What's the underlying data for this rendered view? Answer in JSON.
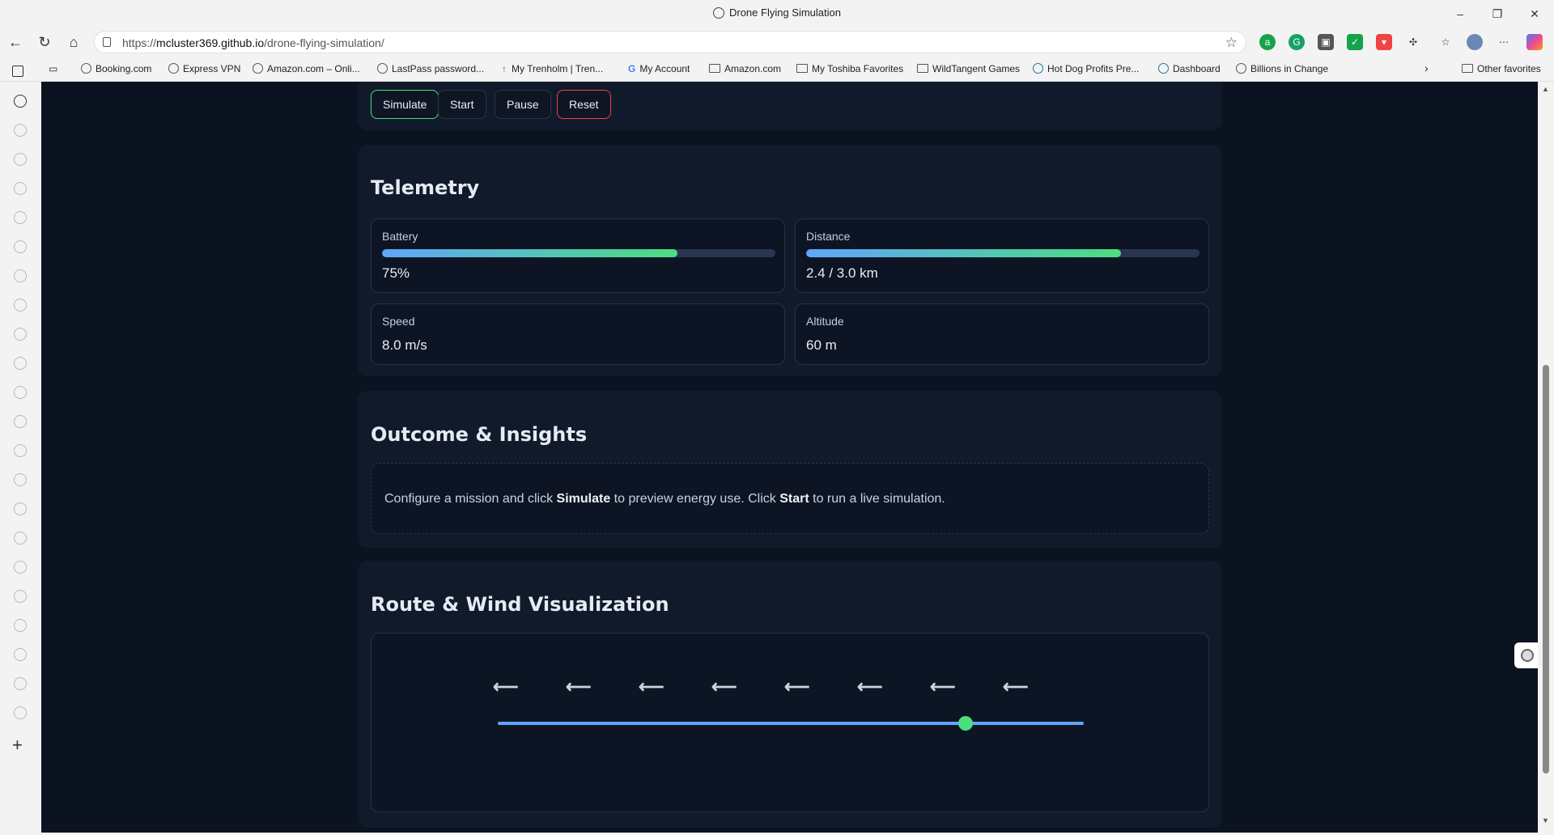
{
  "window": {
    "title": "Drone Flying Simulation",
    "controls": {
      "minimize": "–",
      "restore": "❐",
      "close": "✕"
    }
  },
  "address_bar": {
    "url_prefix": "https://",
    "url_host": "mcluster369.github.io",
    "url_path": "/drone-flying-simulation/"
  },
  "bookmarks": [
    {
      "label": "Booking.com",
      "icon": "globe-icon"
    },
    {
      "label": "Express VPN",
      "icon": "globe-icon"
    },
    {
      "label": "Amazon.com – Onli...",
      "icon": "globe-icon"
    },
    {
      "label": "LastPass password...",
      "icon": "globe-icon"
    },
    {
      "label": "My Trenholm | Tren...",
      "icon": "pin-icon"
    },
    {
      "label": "My Account",
      "icon": "google-icon"
    },
    {
      "label": "Amazon.com",
      "icon": "folder-icon"
    },
    {
      "label": "My Toshiba Favorites",
      "icon": "folder-icon"
    },
    {
      "label": "WildTangent Games",
      "icon": "folder-icon"
    },
    {
      "label": "Hot Dog Profits Pre...",
      "icon": "wordpress-icon"
    },
    {
      "label": "Dashboard",
      "icon": "wordpress-icon"
    },
    {
      "label": "Billions in Change",
      "icon": "globe-icon"
    }
  ],
  "other_favorites": "Other favorites",
  "controls": {
    "simulate": "Simulate",
    "start": "Start",
    "pause": "Pause",
    "reset": "Reset"
  },
  "telemetry": {
    "heading": "Telemetry",
    "battery": {
      "label": "Battery",
      "value": "75%",
      "fraction": 0.75
    },
    "distance": {
      "label": "Distance",
      "value": "2.4 / 3.0 km",
      "fraction": 0.8
    },
    "speed": {
      "label": "Speed",
      "value": "8.0 m/s"
    },
    "altitude": {
      "label": "Altitude",
      "value": "60 m"
    }
  },
  "insights": {
    "heading": "Outcome & Insights",
    "text_1": "Configure a mission and click ",
    "bold_1": "Simulate",
    "text_2": " to preview energy use. Click ",
    "bold_2": "Start",
    "text_3": " to run a live simulation."
  },
  "visualization": {
    "heading": "Route & Wind Visualization",
    "wind_arrow": "⟵",
    "wind_arrow_count": 8,
    "drone_progress": 0.8,
    "colors": {
      "route": "#60a5fa",
      "drone": "#4ade80"
    }
  }
}
